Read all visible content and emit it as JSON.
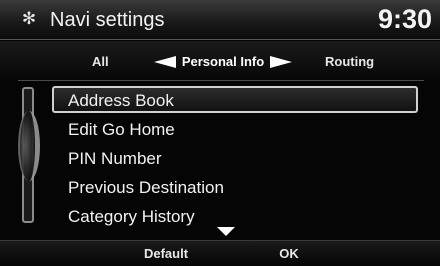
{
  "header": {
    "icon": "gear-icon",
    "title": "Navi settings",
    "clock": "9:30"
  },
  "tabs": {
    "left": "All",
    "current": "Personal Info",
    "right": "Routing"
  },
  "list": {
    "items": [
      {
        "label": "Address Book",
        "selected": true
      },
      {
        "label": "Edit Go Home"
      },
      {
        "label": "PIN Number"
      },
      {
        "label": "Previous Destination"
      },
      {
        "label": "Category History"
      }
    ]
  },
  "footer": {
    "default_label": "Default",
    "ok_label": "OK"
  },
  "colors": {
    "background": "#050505",
    "text": "#f2f2f2",
    "highlight_border": "#d0d0d0"
  }
}
